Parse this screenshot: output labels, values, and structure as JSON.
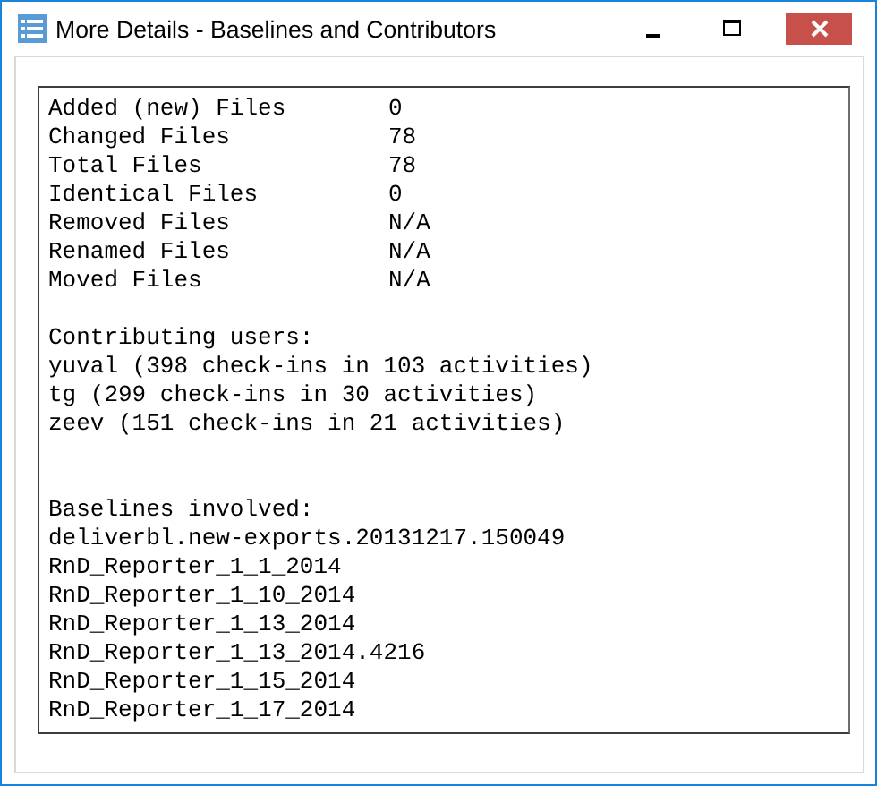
{
  "window": {
    "title": "More Details - Baselines and Contributors"
  },
  "summary": [
    {
      "label": "Added (new) Files",
      "value": "0"
    },
    {
      "label": "Changed Files",
      "value": "78"
    },
    {
      "label": "Total Files",
      "value": "78"
    },
    {
      "label": "Identical Files",
      "value": "0"
    },
    {
      "label": "Removed Files",
      "value": "N/A"
    },
    {
      "label": "Renamed Files",
      "value": "N/A"
    },
    {
      "label": "Moved Files",
      "value": "N/A"
    }
  ],
  "contributors": {
    "heading": "Contributing users:",
    "users": [
      "yuval (398 check-ins in 103 activities)",
      "tg (299 check-ins in 30 activities)",
      "zeev (151 check-ins in 21 activities)"
    ]
  },
  "baselines": {
    "heading": "Baselines involved:",
    "items": [
      "deliverbl.new-exports.20131217.150049",
      "RnD_Reporter_1_1_2014",
      "RnD_Reporter_1_10_2014",
      "RnD_Reporter_1_13_2014",
      "RnD_Reporter_1_13_2014.4216",
      "RnD_Reporter_1_15_2014",
      "RnD_Reporter_1_17_2014"
    ]
  }
}
